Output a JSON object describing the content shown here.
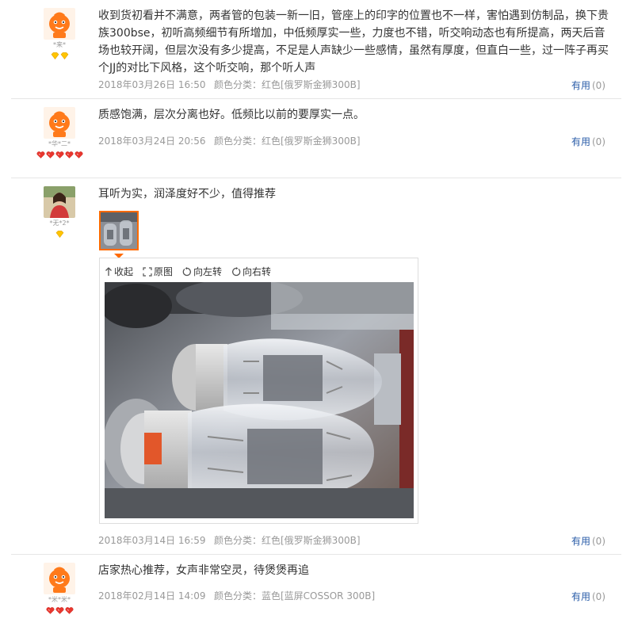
{
  "reviews": [
    {
      "text": "收到货初看并不满意，两者管的包装一新一旧，管座上的印字的位置也不一样，害怕遇到仿制品，换下贵族300bse，初听高频细节有所增加，中低频厚实一些，力度也不错，听交响动态也有所提高，两天后音场也较开阔，但层次没有多少提高，不足是人声缺少一些感情，虽然有厚度，但直白一些，过一阵子再买个JJ的对比下风格，这个听交响，那个听人声",
      "date": "2018年03月26日 16:50",
      "spec": "颜色分类：红色[俄罗斯金狮300B]",
      "useful_label": "有用",
      "useful_count": "(0)",
      "nick": "*来*"
    },
    {
      "text": "质感饱满，层次分离也好。低频比以前的要厚实一点。",
      "date": "2018年03月24日 20:56",
      "spec": "颜色分类：红色[俄罗斯金狮300B]",
      "useful_label": "有用",
      "useful_count": "(0)",
      "nick": "*华*二*"
    },
    {
      "text": "耳听为实，润泽度好不少，值得推荐",
      "date": "2018年03月14日 16:59",
      "spec": "颜色分类：红色[俄罗斯金狮300B]",
      "useful_label": "有用",
      "useful_count": "(0)",
      "nick": "*无*2*",
      "viewer": {
        "collapse": "收起",
        "original": "原图",
        "rotate_left": "向左转",
        "rotate_right": "向右转"
      }
    },
    {
      "text": "店家热心推荐，女声非常空灵，待煲煲再追",
      "date": "2018年02月14日 14:09",
      "spec": "颜色分类：蓝色[蓝屏COSSOR 300B]",
      "useful_label": "有用",
      "useful_count": "(0)",
      "nick": "*米*米*"
    }
  ],
  "colors": {
    "useful_link": "#2a5ca8",
    "meta_gray": "#999999",
    "thumb_border": "#ff6a00",
    "divider": "#e6e6e6"
  }
}
